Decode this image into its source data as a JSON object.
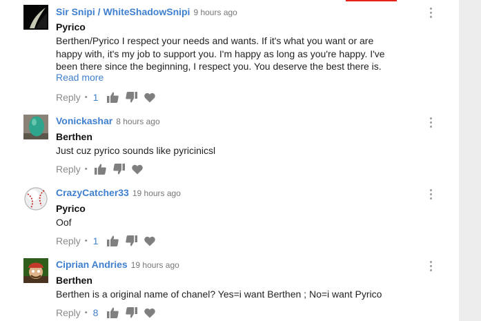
{
  "comments": [
    {
      "author": "Sir Snipi / WhiteShadowSnipi",
      "time": "9 hours ago",
      "title": "Pyrico",
      "text": "Berthen/Pyrico I respect your needs and wants. If it's what you want or are happy with, it's my job to support you. I'm happy as long as you're happy. I've been there since the beginning, I respect you. You deserve the best there is.",
      "read_more": "Read more",
      "reply_label": "Reply",
      "reply_count": "1"
    },
    {
      "author": "Vonickashar",
      "time": "8 hours ago",
      "title": "Berthen",
      "text": "Just cuz pyrico sounds like pyricinicsl",
      "reply_label": "Reply"
    },
    {
      "author": "CrazyCatcher33",
      "time": "19 hours ago",
      "title": "Pyrico",
      "text": "Oof",
      "reply_label": "Reply",
      "reply_count": "1"
    },
    {
      "author": "Ciprian Andries",
      "time": "19 hours ago",
      "title": "Berthen",
      "text": "Berthen is a original name of chanel? Yes=i want  Berthen ; No=i want  Pyrico",
      "reply_label": "Reply",
      "reply_count": "8"
    }
  ],
  "icons": {
    "like": "thumbs-up-icon",
    "dislike": "thumbs-down-icon",
    "heart": "heart-icon",
    "menu": "more-vertical-icon"
  },
  "colors": {
    "author": "#3f7fcf",
    "muted": "#8a8a8a",
    "accent_red": "#e62117"
  }
}
